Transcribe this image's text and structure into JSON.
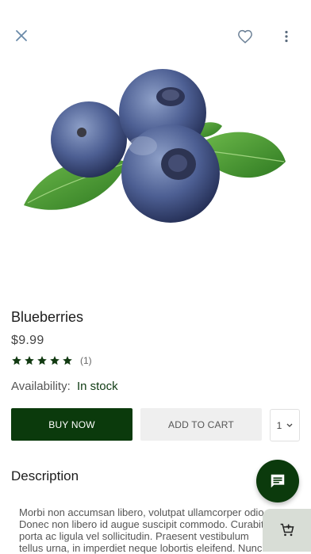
{
  "header": {
    "close_icon": "close-icon",
    "favorite_icon": "heart-outline-icon",
    "more_icon": "more-vert-icon"
  },
  "product": {
    "name": "Blueberries",
    "price": "$9.99",
    "rating": 5,
    "rating_count": "(1)",
    "availability_label": "Availability:",
    "availability_value": "In stock"
  },
  "actions": {
    "buy_now": "BUY NOW",
    "add_to_cart": "ADD TO CART",
    "quantity": "1"
  },
  "description": {
    "title": "Description",
    "lines": [
      "Morbi non accumsan libero, volutpat ullamcorper odio.",
      "Donec non libero id augue suscipit commodo. Curabitur",
      "porta ac ligula vel sollicitudin. Praesent vestibulum",
      "tellus urna, in imperdiet neque lobortis eleifend. Nunc"
    ]
  },
  "colors": {
    "primary": "#0b3a0c",
    "secondary_button": "#efefef",
    "fab_cart": "#d8ddd6"
  },
  "fabs": {
    "chat_icon": "chat-icon",
    "cart_icon": "add-shopping-cart-icon"
  }
}
